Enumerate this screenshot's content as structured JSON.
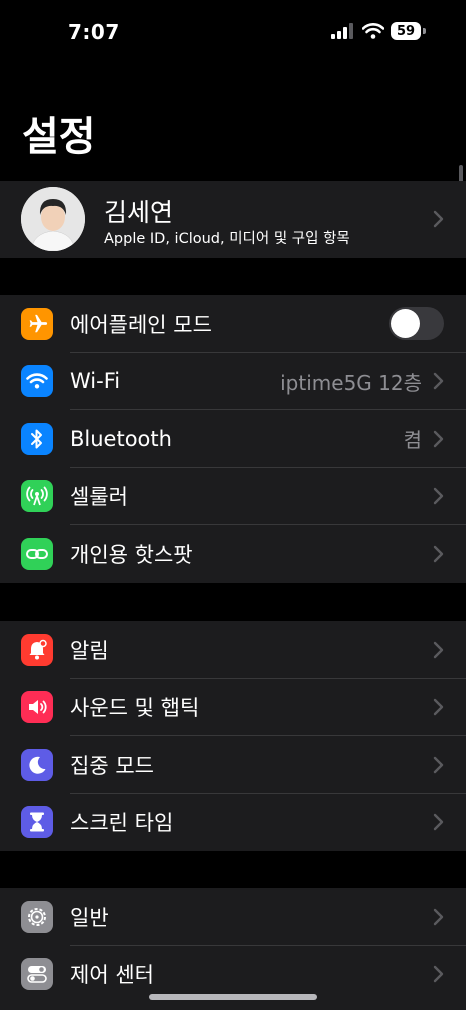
{
  "status": {
    "time": "7:07",
    "battery": "59"
  },
  "title": "설정",
  "profile": {
    "name": "김세연",
    "subtitle": "Apple ID, iCloud, 미디어 및 구입 항목"
  },
  "groups": [
    {
      "items": [
        {
          "label": "에어플레인 모드",
          "icon": "airplane-icon",
          "color": "#ff9500",
          "toggle": false
        },
        {
          "label": "Wi-Fi",
          "value": "iptime5G 12층",
          "icon": "wifi-icon",
          "color": "#0a84ff"
        },
        {
          "label": "Bluetooth",
          "value": "켬",
          "icon": "bluetooth-icon",
          "color": "#0a84ff"
        },
        {
          "label": "셀룰러",
          "icon": "antenna-icon",
          "color": "#30d158"
        },
        {
          "label": "개인용 핫스팟",
          "icon": "hotspot-icon",
          "color": "#30d158"
        }
      ]
    },
    {
      "items": [
        {
          "label": "알림",
          "icon": "bell-icon",
          "color": "#ff3b30"
        },
        {
          "label": "사운드 및 햅틱",
          "icon": "speaker-icon",
          "color": "#ff2d55"
        },
        {
          "label": "집중 모드",
          "icon": "moon-icon",
          "color": "#5e5ce6"
        },
        {
          "label": "스크린 타임",
          "icon": "hourglass-icon",
          "color": "#5e5ce6"
        }
      ]
    },
    {
      "items": [
        {
          "label": "일반",
          "icon": "gear-icon",
          "color": "#8e8e93"
        },
        {
          "label": "제어 센터",
          "icon": "switches-icon",
          "color": "#8e8e93"
        }
      ]
    }
  ]
}
